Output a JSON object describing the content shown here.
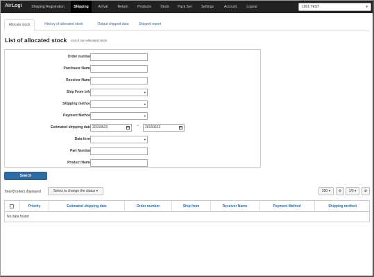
{
  "app": {
    "brand": "AirLogi"
  },
  "nav": {
    "items": [
      {
        "label": "Shipping Registration"
      },
      {
        "label": "Shipping"
      },
      {
        "label": "Arrival"
      },
      {
        "label": "Return"
      },
      {
        "label": "Products"
      },
      {
        "label": "Stock"
      },
      {
        "label": "Pack Set"
      },
      {
        "label": "Settings"
      },
      {
        "label": "Account"
      },
      {
        "label": "Logout"
      }
    ],
    "active": "Shipping",
    "tenant": "1001 TEST"
  },
  "tabs": [
    {
      "label": "Allocate stock"
    },
    {
      "label": "History of allocated stock"
    },
    {
      "label": "Output shipped data"
    },
    {
      "label": "Shipped report"
    }
  ],
  "page": {
    "title": "List of allocated stock",
    "sub_link": "List of non-allocated stock"
  },
  "form": {
    "order_number": {
      "label": "Order number",
      "value": ""
    },
    "purchaser_name": {
      "label": "Purchaser Name",
      "value": ""
    },
    "receiver_name": {
      "label": "Receiver Name",
      "value": ""
    },
    "ship_from_info": {
      "label": "Ship From Info",
      "value": ""
    },
    "shipping_method": {
      "label": "Shipping method",
      "value": ""
    },
    "payment_method": {
      "label": "Payment Method",
      "value": ""
    },
    "estimated_shipping_date": {
      "label": "Estimated shipping date",
      "from": "20160622",
      "separator": "~",
      "to": "20160622"
    },
    "data_form": {
      "label": "Data form",
      "value": ""
    },
    "part_number": {
      "label": "Part Number",
      "value": ""
    },
    "product_name": {
      "label": "Product Name",
      "value": ""
    },
    "search_label": "Search"
  },
  "results": {
    "total_prefix": "Total",
    "total_count": "0",
    "total_suffix": "orders displayed",
    "status_button": "Select to change the status",
    "page_size": "200",
    "pagination": "1/0",
    "table": {
      "headers": [
        "Priority",
        "Estimated shipping date",
        "Order number",
        "Ship-from",
        "Receiver Name",
        "Payment Method",
        "Shipping method"
      ],
      "empty": "No data found"
    }
  }
}
